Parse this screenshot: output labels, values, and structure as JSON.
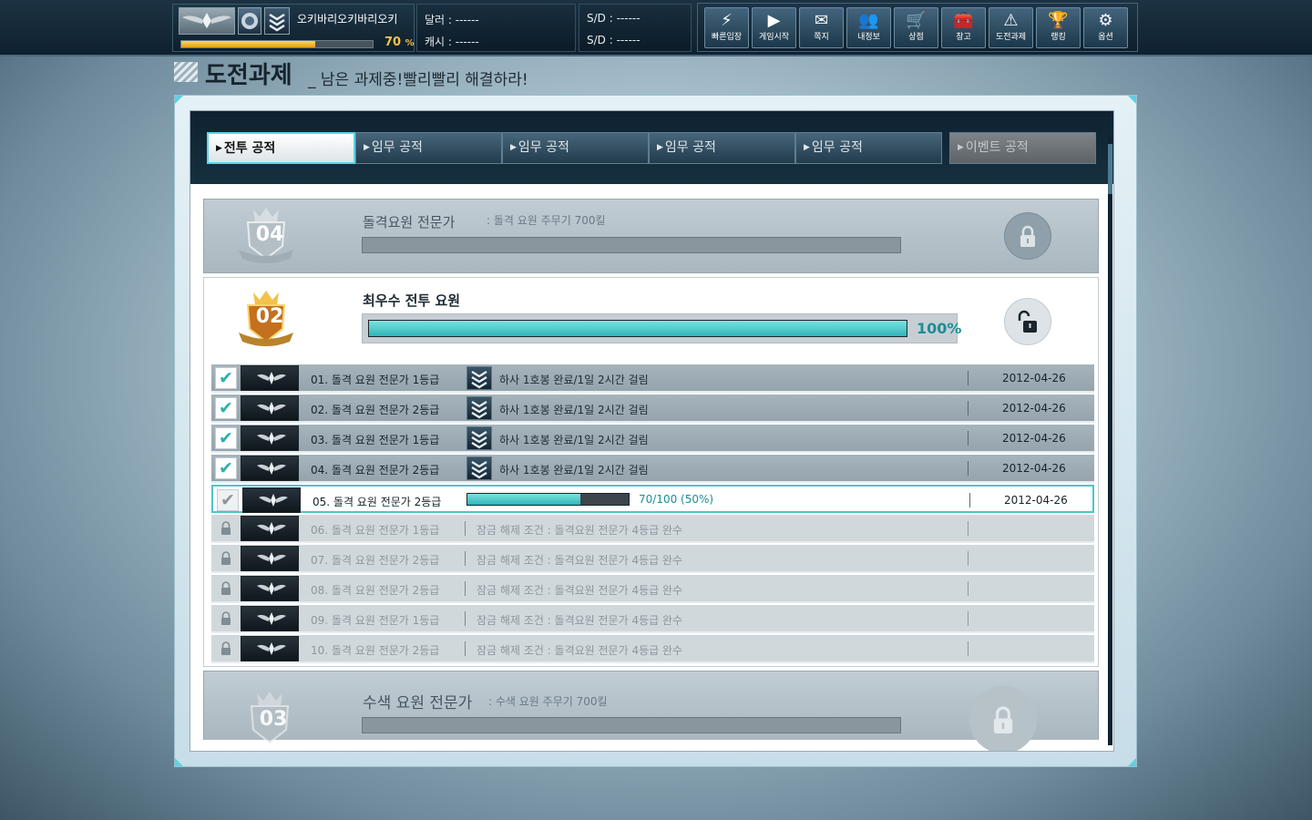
{
  "topbar": {
    "nickname": "오키바리오키바리오키",
    "exp_percent": 70,
    "exp_percent_value": "70",
    "exp_percent_unit": "%",
    "dollar_label": "달러 : ------",
    "cash_label": "캐시 : ------",
    "sd_label_1": "S/D : ------",
    "sd_label_2": "S/D : ------",
    "menu": [
      {
        "label": "빠른입장",
        "icon": "lightning-icon",
        "glyph": "⚡"
      },
      {
        "label": "게임시작",
        "icon": "play-icon",
        "glyph": "▶"
      },
      {
        "label": "쪽지",
        "icon": "mail-icon",
        "glyph": "✉"
      },
      {
        "label": "내정보",
        "icon": "profile-icon",
        "glyph": "👥"
      },
      {
        "label": "상점",
        "icon": "cart-icon",
        "glyph": "🛒"
      },
      {
        "label": "창고",
        "icon": "inventory-icon",
        "glyph": "🧰"
      },
      {
        "label": "도전과제",
        "icon": "challenge-icon",
        "glyph": "⚠"
      },
      {
        "label": "랭킹",
        "icon": "trophy-icon",
        "glyph": "🏆"
      },
      {
        "label": "옵션",
        "icon": "gear-icon",
        "glyph": "⚙"
      }
    ]
  },
  "page": {
    "title": "도전과제",
    "subtitle": "_ 남은 과제중!빨리빨리 해결하라!"
  },
  "tabs": [
    {
      "label": "전투 공적",
      "state": "active"
    },
    {
      "label": "임무 공적",
      "state": "normal"
    },
    {
      "label": "임무 공적",
      "state": "normal"
    },
    {
      "label": "임무 공적",
      "state": "normal"
    },
    {
      "label": "임무 공적",
      "state": "normal"
    },
    {
      "label": "이벤트 공적",
      "state": "disabled"
    }
  ],
  "categories": {
    "top": {
      "badge_number": "04",
      "title": "돌격요원 전문가",
      "description": ": 돌격 요원 주무기 700킬",
      "locked": true
    },
    "open": {
      "badge_number": "02",
      "title": "최우수 전투 요원",
      "progress_percent": 100,
      "progress_label": "100%",
      "locked": false
    },
    "bottom": {
      "badge_number": "03",
      "title": "수색 요원 전문가",
      "description": ": 수색 요원 주무기 700킬",
      "locked": true
    }
  },
  "rows": [
    {
      "name": "01. 돌격 요원 전문가 1등급",
      "task": "하사 1호봉 완료/1일 2시간 걸림",
      "date": "2012-04-26",
      "state": "done"
    },
    {
      "name": "02. 돌격 요원 전문가 2등급",
      "task": "하사 1호봉 완료/1일 2시간 걸림",
      "date": "2012-04-26",
      "state": "done"
    },
    {
      "name": "03. 돌격 요원 전문가 1등급",
      "task": "하사 1호봉 완료/1일 2시간 걸림",
      "date": "2012-04-26",
      "state": "done"
    },
    {
      "name": "04. 돌격 요원 전문가 2등급",
      "task": "하사 1호봉 완료/1일 2시간 걸림",
      "date": "2012-04-26",
      "state": "done"
    },
    {
      "name": "05. 돌격 요원 전문가 2등급",
      "progress_value": 70,
      "progress_max": 100,
      "progress_text": "70/100 (50%)",
      "date": "2012-04-26",
      "state": "current"
    },
    {
      "name": "06. 돌격 요원 전문가 1등급",
      "unlock": "잠금 해제 조건 : 돌격요원 전문가 4등급 완수",
      "state": "locked"
    },
    {
      "name": "07. 돌격 요원 전문가 2등급",
      "unlock": "잠금 해제 조건 : 돌격요원 전문가 4등급 완수",
      "state": "locked"
    },
    {
      "name": "08. 돌격 요원 전문가 2등급",
      "unlock": "잠금 해제 조건 : 돌격요원 전문가 4등급 완수",
      "state": "locked"
    },
    {
      "name": "09. 돌격 요원 전문가 1등급",
      "unlock": "잠금 해제 조건 : 돌격요원 전문가 4등급 완수",
      "state": "locked"
    },
    {
      "name": "10. 돌격 요원 전문가 2등급",
      "unlock": "잠금 해제 조건 : 돌격요원 전문가 4등급 완수",
      "state": "locked"
    }
  ],
  "colors": {
    "accent": "#4fc5c8",
    "exp_bar": "#f3c24a",
    "progress": "#2fb4b7"
  }
}
